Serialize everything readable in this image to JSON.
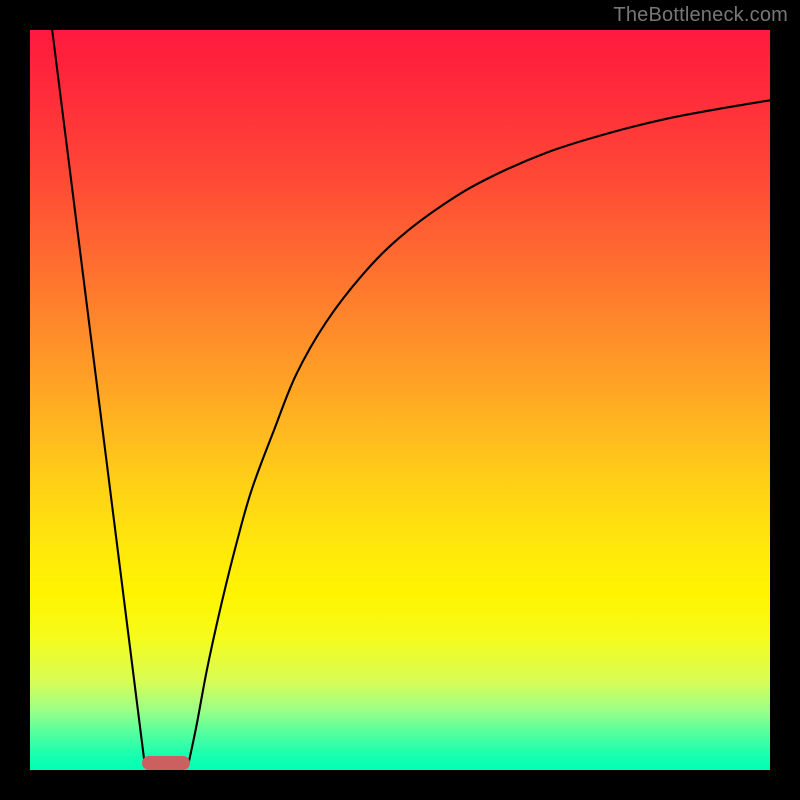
{
  "watermark": "TheBottleneck.com",
  "marker": {
    "x_pct": 18.4,
    "y_pct": 99.0,
    "color": "#cc6060"
  },
  "chart_data": {
    "type": "line",
    "title": "",
    "xlabel": "",
    "ylabel": "",
    "xlim": [
      0,
      100
    ],
    "ylim": [
      0,
      100
    ],
    "grid": false,
    "series": [
      {
        "name": "left-line",
        "x": [
          3.0,
          15.5
        ],
        "y": [
          100.0,
          0.8
        ]
      },
      {
        "name": "right-curve",
        "x": [
          21.4,
          22.5,
          24.0,
          26.0,
          28.0,
          30.0,
          33.0,
          36.0,
          40.0,
          45.0,
          50.0,
          56.0,
          62.0,
          70.0,
          78.0,
          86.0,
          94.0,
          100.0
        ],
        "y": [
          0.8,
          6.0,
          14.0,
          23.0,
          31.0,
          38.0,
          46.0,
          53.5,
          60.5,
          67.0,
          72.0,
          76.5,
          80.0,
          83.5,
          86.0,
          88.0,
          89.5,
          90.5
        ]
      }
    ],
    "annotations": [
      {
        "type": "pill",
        "x": 18.4,
        "y": 0.8,
        "color": "#cc6060"
      }
    ],
    "background_gradient": {
      "direction": "vertical",
      "stops": [
        {
          "pos": 0.0,
          "color": "#ff1a3e"
        },
        {
          "pos": 0.32,
          "color": "#ff6f2f"
        },
        {
          "pos": 0.62,
          "color": "#ffd215"
        },
        {
          "pos": 0.82,
          "color": "#f6fb1a"
        },
        {
          "pos": 1.0,
          "color": "#00ffb4"
        }
      ]
    }
  }
}
